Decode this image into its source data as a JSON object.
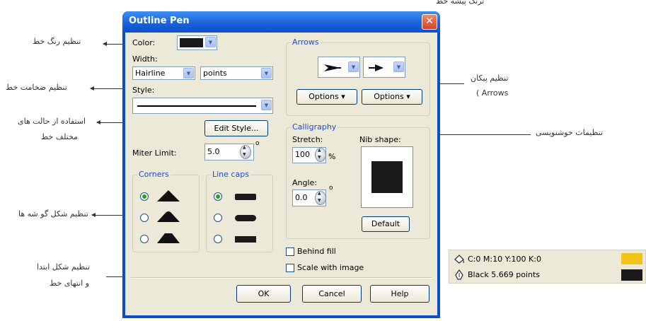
{
  "header_text": "ترنگ پیشه خط",
  "annotations": {
    "color": "تنظیم رنگ خط",
    "width": "تنظیم ضخامت خط",
    "style_line1": "استفاده از حالت های",
    "style_line2": "مختلف خط",
    "corners": "تنظیم شکل گو شه ها",
    "linecaps_line1": "تنظیم شکل ابتدا",
    "linecaps_line2": "و انتهای خط",
    "arrows_line1": "تنظیم پیکان",
    "arrows_line2": "( Arrows",
    "calligraphy": "تنظیمات خوشنویسی"
  },
  "dialog": {
    "title": "Outline Pen",
    "close_glyph": "✕",
    "color_label": "Color:",
    "color_value": "#1a1a1a",
    "width_label": "Width:",
    "width_value": "Hairline",
    "units_value": "points",
    "style_label": "Style:",
    "edit_style_label": "Edit Style...",
    "miter_label": "Miter Limit:",
    "miter_value": "5.0",
    "miter_unit": "o",
    "corners_title": "Corners",
    "linecaps_title": "Line caps",
    "arrows_title": "Arrows",
    "options_left": "Options",
    "options_right": "Options",
    "options_glyph": "▾",
    "calligraphy_title": "Calligraphy",
    "stretch_label": "Stretch:",
    "stretch_value": "100",
    "stretch_unit": "%",
    "angle_label": "Angle:",
    "angle_value": "0.0",
    "angle_unit": "o",
    "nib_shape_label": "Nib shape:",
    "default_label": "Default",
    "behind_fill_label": "Behind fill",
    "scale_with_image_label": "Scale with image",
    "ok_label": "OK",
    "cancel_label": "Cancel",
    "help_label": "Help",
    "drop_glyph": "▼"
  },
  "status_panel": {
    "fill_text": "C:0 M:10 Y:100 K:0",
    "fill_color": "#f2c418",
    "outline_text": "Black  5.669 points",
    "outline_color": "#1a1a1a"
  }
}
